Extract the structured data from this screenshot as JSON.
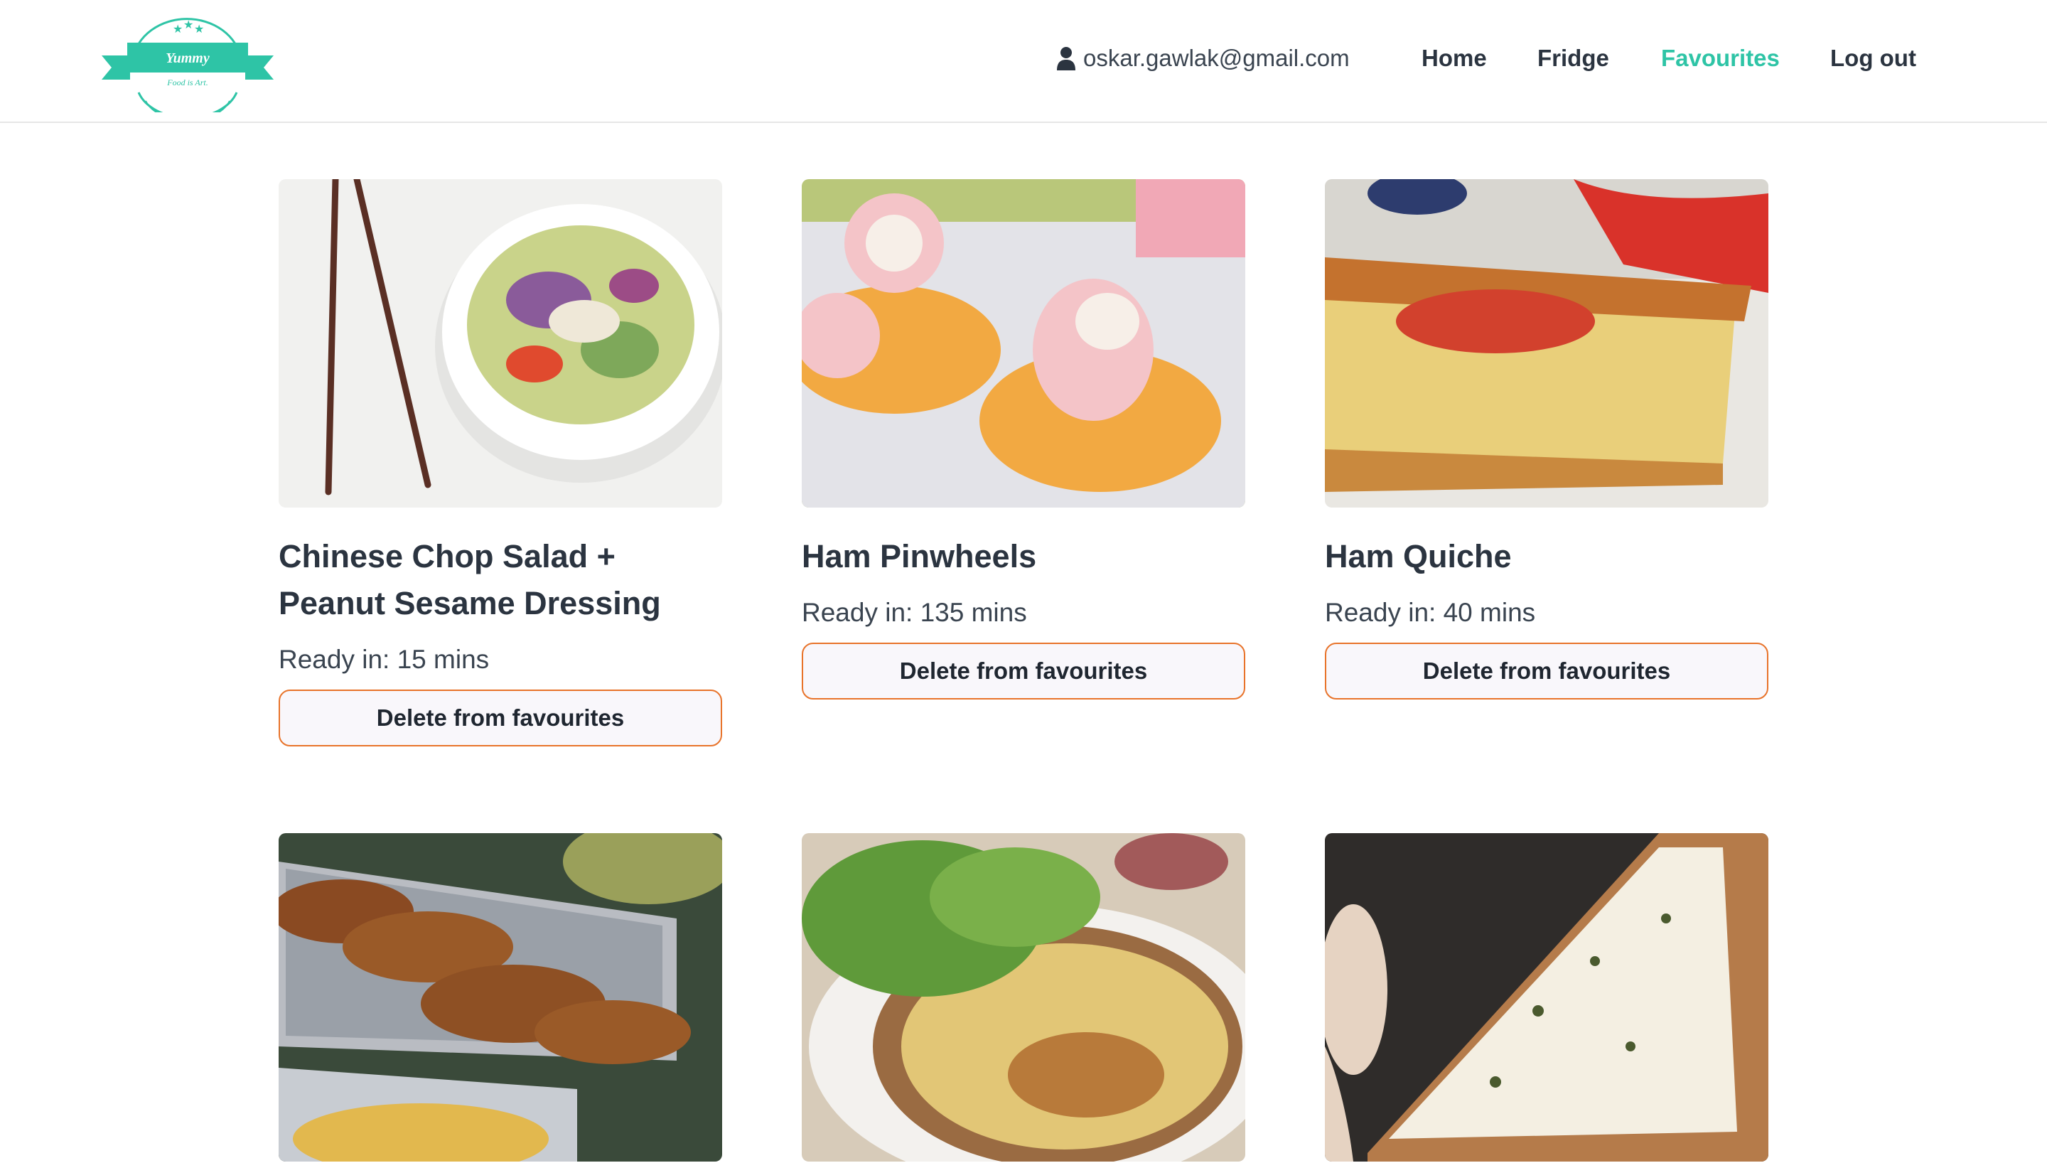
{
  "header": {
    "logo": {
      "brand": "Yummy",
      "tagline": "Food is Art."
    },
    "user_email": "oskar.gawlak@gmail.com",
    "nav": {
      "home": "Home",
      "fridge": "Fridge",
      "favourites": "Favourites",
      "logout": "Log out"
    },
    "active_nav": "Favourites"
  },
  "colors": {
    "accent": "#2ec4a6",
    "button_border": "#e8732a",
    "text": "#2b3440"
  },
  "recipes": [
    {
      "title": "Chinese Chop Salad + Peanut Sesame Dressing",
      "ready": "Ready in: 15 mins",
      "button": "Delete from favourites",
      "image": "salad-bowl-with-chopsticks"
    },
    {
      "title": "Ham Pinwheels",
      "ready": "Ready in: 135 mins",
      "button": "Delete from favourites",
      "image": "ham-pinwheels-on-crackers"
    },
    {
      "title": "Ham Quiche",
      "ready": "Ready in: 40 mins",
      "button": "Delete from favourites",
      "image": "ham-quiche-slice"
    },
    {
      "image": "breaded-chicken-tray"
    },
    {
      "image": "quiche-with-salad"
    },
    {
      "image": "white-pizza-slice"
    }
  ]
}
